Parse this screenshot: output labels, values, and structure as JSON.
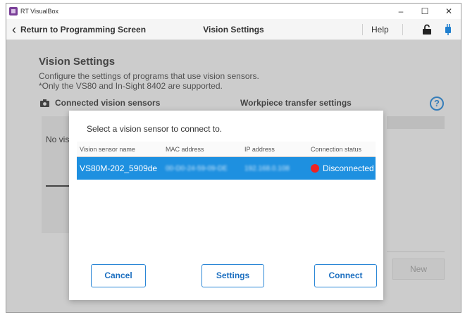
{
  "window": {
    "title": "RT VisualBox",
    "controls": {
      "minimize": "–",
      "maximize": "☐",
      "close": "✕"
    }
  },
  "header": {
    "back_label": "Return to Programming Screen",
    "title": "Vision Settings",
    "help_label": "Help"
  },
  "page": {
    "title": "Vision Settings",
    "desc1": "Configure the settings of programs that use vision sensors.",
    "desc2": "*Only the VS80 and In-Sight 8402 are supported.",
    "section_left": "Connected vision sensors",
    "section_right": "Workpiece transfer settings",
    "help_circle": "?",
    "panel_text": "No visio",
    "new_button": "New"
  },
  "dialog": {
    "prompt": "Select a vision sensor to connect to.",
    "columns": [
      "Vision sensor name",
      "MAC address",
      "IP address",
      "Connection status"
    ],
    "rows": [
      {
        "name": "VS80M-202_5909de",
        "mac": "00-D0-24-59-09-DE",
        "ip": "192.168.0.108",
        "status": "Disconnected"
      }
    ],
    "buttons": {
      "cancel": "Cancel",
      "settings": "Settings",
      "connect": "Connect"
    }
  },
  "colors": {
    "accent": "#1e90e0",
    "button_border": "#2a86d6",
    "status_disconnected": "#e22222",
    "help_blue": "#1f7fcf"
  },
  "icons": [
    "chevron-left-icon",
    "lock-icon",
    "power-plug-icon",
    "camera-icon",
    "help-icon"
  ]
}
